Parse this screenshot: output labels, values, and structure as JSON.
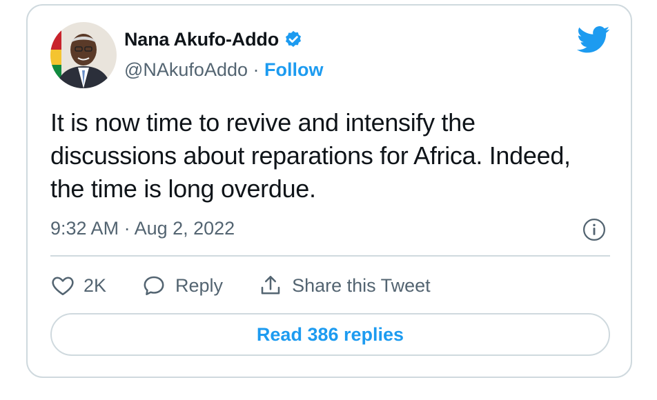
{
  "tweet": {
    "author_name": "Nana Akufo-Addo",
    "handle": "@NAkufoAddo",
    "separator": " · ",
    "follow_label": "Follow",
    "text": "It is now time to revive and intensify the discussions about reparations for Africa. Indeed, the time is long overdue.",
    "timestamp": "9:32 AM · Aug 2, 2022",
    "likes_count": "2K",
    "reply_label": "Reply",
    "share_label": "Share this Tweet",
    "read_replies_label": "Read 386 replies"
  },
  "icons": {
    "verified": "verified-badge-icon",
    "brand": "twitter-bird-icon",
    "info": "info-icon",
    "like": "heart-icon",
    "reply": "speech-bubble-icon",
    "share": "share-upload-icon"
  },
  "colors": {
    "accent": "#1d9bf0",
    "text_primary": "#0f1419",
    "text_secondary": "#536471",
    "border": "#cfd9de"
  }
}
